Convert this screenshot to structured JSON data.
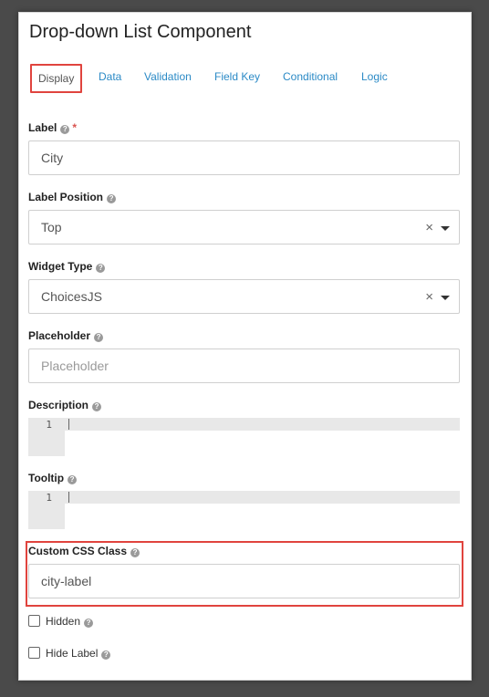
{
  "title": "Drop-down List Component",
  "tabs": [
    {
      "label": "Display",
      "active": true
    },
    {
      "label": "Data"
    },
    {
      "label": "Validation"
    },
    {
      "label": "Field Key"
    },
    {
      "label": "Conditional"
    },
    {
      "label": "Logic"
    }
  ],
  "fields": {
    "label": {
      "label": "Label",
      "required_marker": "*",
      "value": "City"
    },
    "label_position": {
      "label": "Label Position",
      "value": "Top"
    },
    "widget_type": {
      "label": "Widget Type",
      "value": "ChoicesJS"
    },
    "placeholder": {
      "label": "Placeholder",
      "placeholder": "Placeholder"
    },
    "description": {
      "label": "Description",
      "line_number": "1"
    },
    "tooltip": {
      "label": "Tooltip",
      "line_number": "1"
    },
    "custom_css_class": {
      "label": "Custom CSS Class",
      "value": "city-label"
    }
  },
  "checkboxes": {
    "hidden": {
      "label": "Hidden",
      "checked": false
    },
    "hide_label": {
      "label": "Hide Label",
      "checked": false
    }
  },
  "icons": {
    "help": "?",
    "clear": "×"
  },
  "colors": {
    "accent_link": "#2b8ac6",
    "highlight": "#e0443e",
    "required": "#d9534f"
  }
}
